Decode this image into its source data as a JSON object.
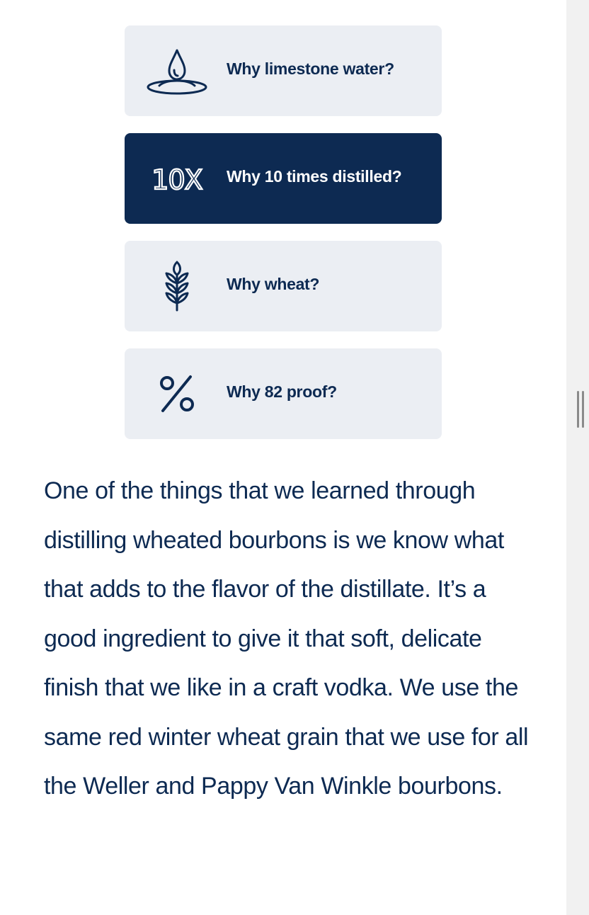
{
  "cards": [
    {
      "label": "Why limestone water?",
      "icon": "water-drop-icon",
      "active": false
    },
    {
      "label": "Why 10 times distilled?",
      "icon": "10x-icon",
      "icon_text": "10X",
      "active": true
    },
    {
      "label": "Why wheat?",
      "icon": "wheat-icon",
      "active": false
    },
    {
      "label": "Why 82 proof?",
      "icon": "percent-icon",
      "active": false
    }
  ],
  "body_text": "One of the things that we learned through distilling wheated bourbons is we know what that adds to the flavor of the distillate. It’s a good ingredient to give it that soft, delicate finish that we like in a craft vodka. We use the same red winter wheat grain that we use for all the Weller and Pappy Van Winkle bourbons.",
  "colors": {
    "navy": "#0d2a52",
    "card_bg": "#ebeef3",
    "white": "#ffffff"
  }
}
